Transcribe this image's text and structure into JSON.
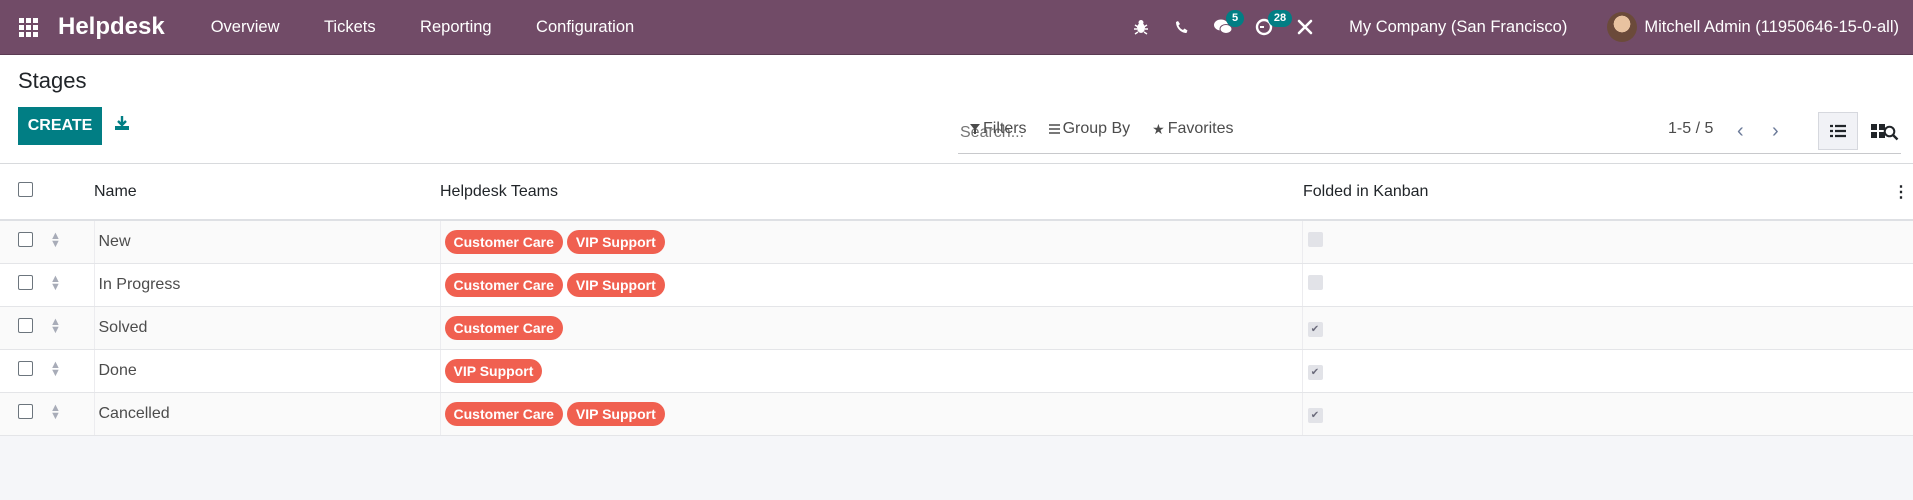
{
  "navbar": {
    "app_name": "Helpdesk",
    "menu": [
      "Overview",
      "Tickets",
      "Reporting",
      "Configuration"
    ],
    "messages_badge": "5",
    "activities_badge": "28",
    "company": "My Company (San Francisco)",
    "user": "Mitchell Admin (11950646-15-0-all)",
    "icons": [
      "apps-grid-icon",
      "bug-icon",
      "phone-icon",
      "chat-icon",
      "clock-icon",
      "tools-icon"
    ]
  },
  "control_panel": {
    "title": "Stages",
    "create_label": "CREATE",
    "search_placeholder": "Search...",
    "filters_label": "Filters",
    "groupby_label": "Group By",
    "favorites_label": "Favorites",
    "pager": "1-5 / 5"
  },
  "table": {
    "columns": [
      "Name",
      "Helpdesk Teams",
      "Folded in Kanban"
    ],
    "rows": [
      {
        "name": "New",
        "teams": [
          "Customer Care",
          "VIP Support"
        ],
        "folded": false
      },
      {
        "name": "In Progress",
        "teams": [
          "Customer Care",
          "VIP Support"
        ],
        "folded": false
      },
      {
        "name": "Solved",
        "teams": [
          "Customer Care"
        ],
        "folded": true
      },
      {
        "name": "Done",
        "teams": [
          "VIP Support"
        ],
        "folded": true
      },
      {
        "name": "Cancelled",
        "teams": [
          "Customer Care",
          "VIP Support"
        ],
        "folded": true
      }
    ]
  },
  "colors": {
    "brand": "#714b67",
    "primary": "#017e84",
    "tag": "#f06050"
  }
}
